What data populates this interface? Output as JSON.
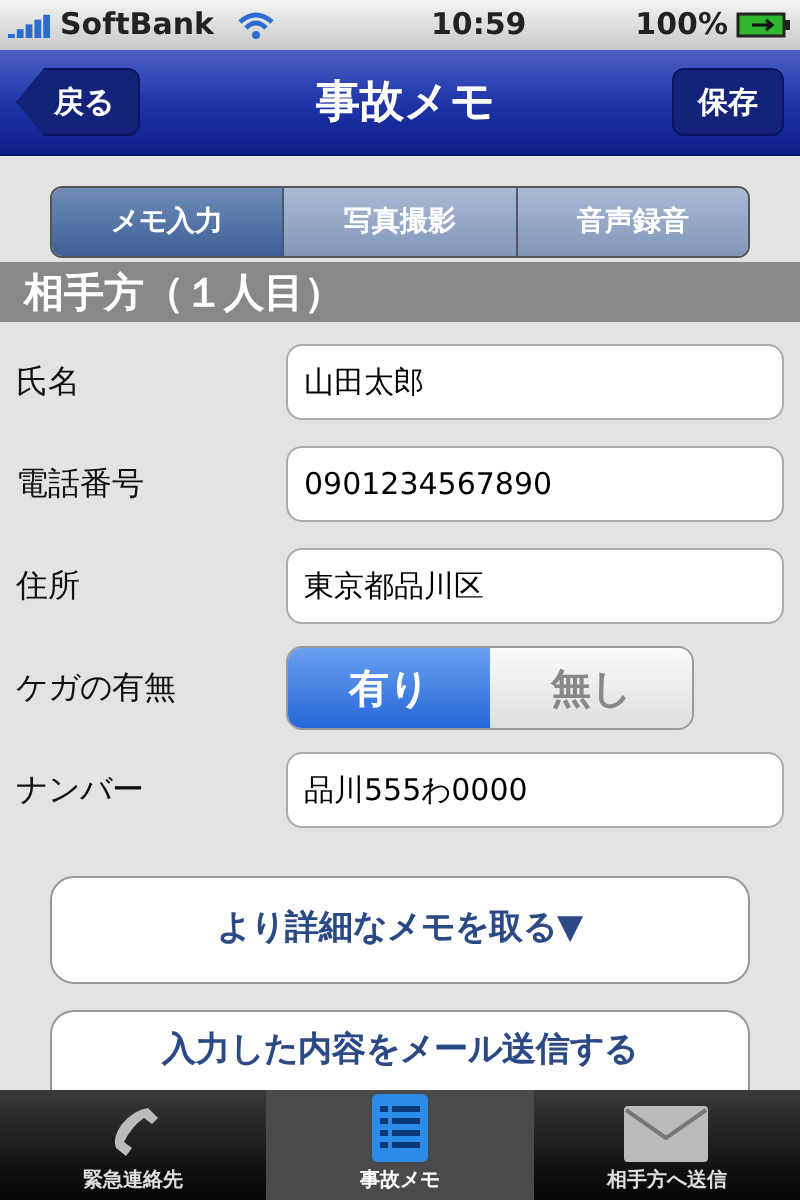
{
  "status_bar": {
    "carrier": "SoftBank",
    "time": "10:59",
    "battery": "100%"
  },
  "nav": {
    "back": "戻る",
    "title": "事故メモ",
    "save": "保存"
  },
  "tabs": [
    {
      "label": "メモ入力",
      "selected": true
    },
    {
      "label": "写真撮影",
      "selected": false
    },
    {
      "label": "音声録音",
      "selected": false
    }
  ],
  "section": "相手方（１人目）",
  "fields": [
    {
      "kind": "text",
      "label": "氏名",
      "value": "山田太郎"
    },
    {
      "kind": "text",
      "label": "電話番号",
      "value": "0901234567890"
    },
    {
      "kind": "text",
      "label": "住所",
      "value": "東京都品川区"
    },
    {
      "kind": "toggle",
      "label": "ケガの有無",
      "options": [
        {
          "label": "有り",
          "selected": true
        },
        {
          "label": "無し",
          "selected": false
        }
      ]
    },
    {
      "kind": "text",
      "label": "ナンバー",
      "value": "品川555わ0000"
    }
  ],
  "buttons": [
    "より詳細なメモを取る▼",
    "入力した内容をメール送信する"
  ],
  "tab_bar": [
    {
      "kind": "phone",
      "label": "緊急連絡先",
      "selected": false
    },
    {
      "kind": "list",
      "label": "事故メモ",
      "selected": true
    },
    {
      "kind": "mail",
      "label": "相手方へ送信",
      "selected": false
    }
  ]
}
